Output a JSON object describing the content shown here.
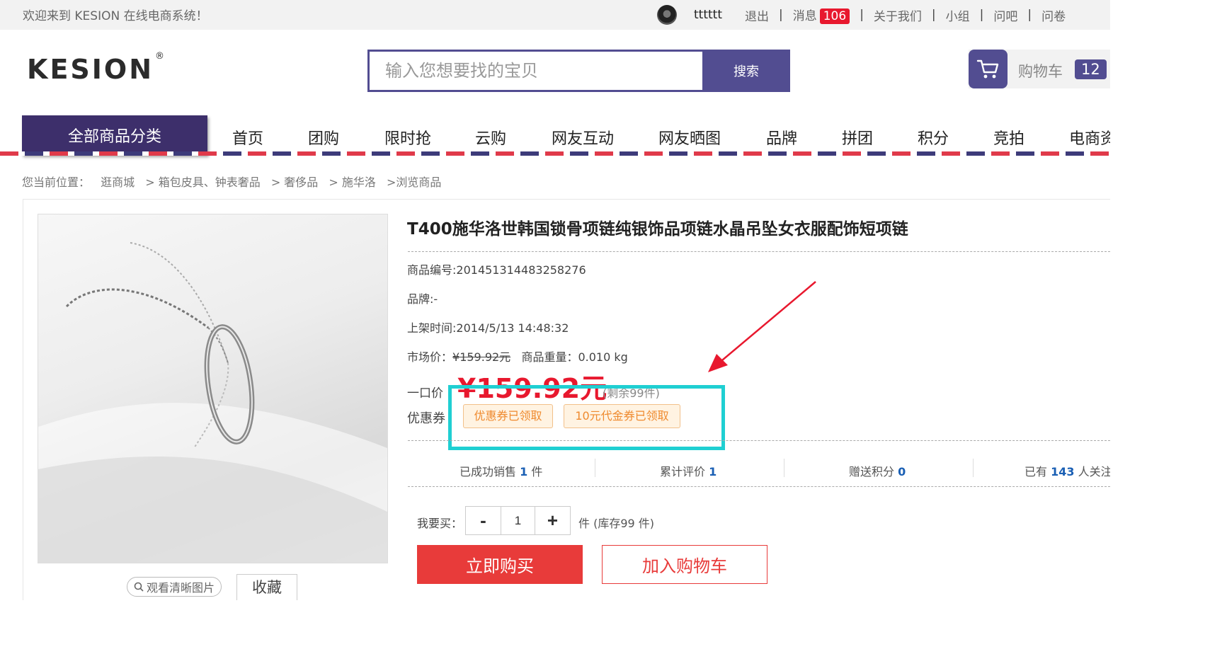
{
  "topbar": {
    "welcome": "欢迎来到 KESION 在线电商系统！",
    "username": "tttttt",
    "logout": "退出",
    "messages": "消息",
    "message_count": "106",
    "about": "关于我们",
    "group": "小组",
    "ask": "问吧",
    "survey": "问卷"
  },
  "header": {
    "logo": "KESION",
    "logo_mark": "®",
    "search_placeholder": "输入您想要找的宝贝",
    "search_button": "搜索",
    "cart_label": "购物车",
    "cart_count": "12"
  },
  "nav": {
    "all_categories": "全部商品分类",
    "items": [
      "首页",
      "团购",
      "限时抢",
      "云购",
      "网友互动",
      "网友晒图",
      "品牌",
      "拼团",
      "积分",
      "竞拍",
      "电商资"
    ]
  },
  "breadcrumb": [
    "您当前位置：",
    "逛商城",
    "> 箱包皮具、钟表奢品",
    "> 奢侈品",
    "> 施华洛",
    ">浏览商品"
  ],
  "product": {
    "view_image": "观看清晰图片",
    "favorite": "收藏",
    "title": "T400施华洛世韩国锁骨项链纯银饰品项链水晶吊坠女衣服配饰短项链",
    "sku_label": "商品编号:",
    "sku": "201451314483258276",
    "brand_label": "品牌:",
    "brand": "-",
    "listed_label": "上架时间:",
    "listed": "2014/5/13 14:48:32",
    "market_price_label": "市场价：",
    "market_price": "¥159.92元",
    "weight_label": "商品重量：",
    "weight": "0.010 kg",
    "price_label": "一口价",
    "price": "¥159.92元",
    "remaining": "(剩余99件)",
    "coupon_label": "优惠券",
    "coupons": [
      "优惠券已领取",
      "10元代金券已领取"
    ],
    "stats": {
      "sold_prefix": "已成功销售",
      "sold": "1",
      "sold_suffix": "件",
      "reviews_prefix": "累计评价",
      "reviews": "1",
      "points_prefix": "赠送积分",
      "points": "0",
      "followers_prefix": "已有",
      "followers": "143",
      "followers_suffix": "人关注"
    },
    "qty_label": "我要买：",
    "qty_minus": "-",
    "qty_value": "1",
    "qty_plus": "+",
    "stock": "件 (库存99 件)",
    "buy_now": "立即购买",
    "add_to_cart": "加入购物车"
  },
  "colors": {
    "brand_purple": "#524d91",
    "nav_purple": "#3d2f6b",
    "price_red": "#e8182e",
    "highlight_cyan": "#1fcfd2",
    "coupon_orange": "#ef8a2e"
  }
}
